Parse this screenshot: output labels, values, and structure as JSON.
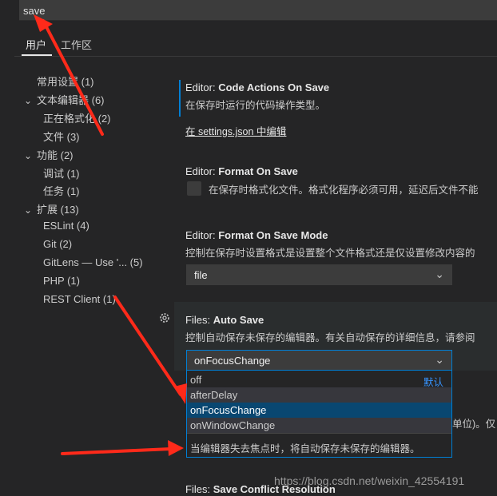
{
  "search": {
    "value": "save"
  },
  "tabs": [
    {
      "label": "用户",
      "active": true
    },
    {
      "label": "工作区",
      "active": false
    }
  ],
  "toc": [
    {
      "label": "常用设置 (1)",
      "level": 0,
      "chevron": ""
    },
    {
      "label": "文本编辑器 (6)",
      "level": 0,
      "chevron": "chevron-down"
    },
    {
      "label": "正在格式化 (2)",
      "level": 1,
      "chevron": ""
    },
    {
      "label": "文件 (3)",
      "level": 1,
      "chevron": ""
    },
    {
      "label": "功能 (2)",
      "level": 0,
      "chevron": "chevron-down"
    },
    {
      "label": "调试 (1)",
      "level": 1,
      "chevron": ""
    },
    {
      "label": "任务 (1)",
      "level": 1,
      "chevron": ""
    },
    {
      "label": "扩展 (13)",
      "level": 0,
      "chevron": "chevron-down"
    },
    {
      "label": "ESLint (4)",
      "level": 1,
      "chevron": ""
    },
    {
      "label": "Git (2)",
      "level": 1,
      "chevron": ""
    },
    {
      "label": "GitLens — Use '...  (5)",
      "level": 1,
      "chevron": ""
    },
    {
      "label": "PHP (1)",
      "level": 1,
      "chevron": ""
    },
    {
      "label": "REST Client (1)",
      "level": 1,
      "chevron": ""
    }
  ],
  "settings": {
    "code_actions": {
      "category": "Editor:",
      "name": "Code Actions On Save",
      "desc": "在保存时运行的代码操作类型。",
      "link": "在 settings.json 中编辑"
    },
    "format_on_save": {
      "category": "Editor:",
      "name": "Format On Save",
      "desc": "在保存时格式化文件。格式化程序必须可用，延迟后文件不能"
    },
    "format_on_save_mode": {
      "category": "Editor:",
      "name": "Format On Save Mode",
      "desc": "控制在保存时设置格式是设置整个文件格式还是仅设置修改内容的",
      "value": "file"
    },
    "auto_save": {
      "category": "Files:",
      "name": "Auto Save",
      "desc": "控制自动保存未保存的编辑器。有关自动保存的详细信息，请参阅",
      "value": "onFocusChange",
      "options": [
        "off",
        "afterDelay",
        "onFocusChange",
        "onWindowChange"
      ],
      "default_label": "默认",
      "option_desc": "当编辑器失去焦点时，将自动保存未保存的编辑器。"
    },
    "hidden_tail": "单位)。仅",
    "save_conflict": {
      "category": "Files:",
      "name": "Save Conflict Resolution"
    }
  },
  "watermark": "https://blog.csdn.net/weixin_42554191",
  "colors": {
    "accent": "#007fd4",
    "arrow": "#ff2a1a",
    "link": "#3794ff"
  },
  "icons": [
    "gear-icon",
    "chevron-down-icon"
  ]
}
